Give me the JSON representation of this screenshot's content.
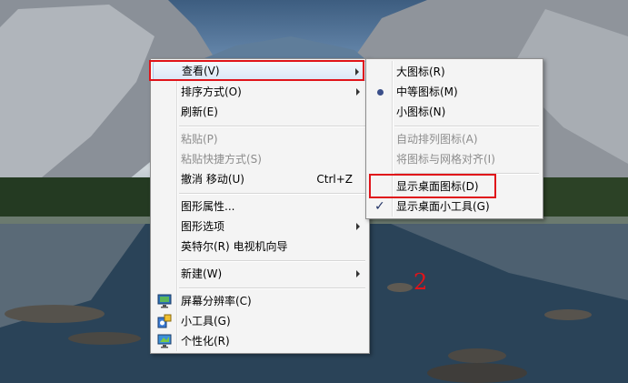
{
  "main_menu": {
    "items": [
      {
        "label": "查看(V)",
        "submenu": true,
        "highlighted": true
      },
      {
        "label": "排序方式(O)",
        "submenu": true
      },
      {
        "label": "刷新(E)"
      },
      {
        "label": "粘贴(P)",
        "disabled": true
      },
      {
        "label": "粘贴快捷方式(S)",
        "disabled": true
      },
      {
        "label": "撤消 移动(U)",
        "shortcut": "Ctrl+Z"
      },
      {
        "label": "图形属性..."
      },
      {
        "label": "图形选项",
        "submenu": true
      },
      {
        "label": "英特尔(R) 电视机向导"
      },
      {
        "label": "新建(W)",
        "submenu": true
      },
      {
        "label": "屏幕分辨率(C)",
        "icon": "display-icon"
      },
      {
        "label": "小工具(G)",
        "icon": "gadgets-icon"
      },
      {
        "label": "个性化(R)",
        "icon": "personalize-icon"
      }
    ]
  },
  "view_submenu": {
    "items": [
      {
        "label": "大图标(R)"
      },
      {
        "label": "中等图标(M)",
        "selected": true,
        "marker": "radio-bullet"
      },
      {
        "label": "小图标(N)"
      },
      {
        "label": "自动排列图标(A)",
        "disabled": true
      },
      {
        "label": "将图标与网格对齐(I)",
        "disabled": true
      },
      {
        "label": "显示桌面图标(D)"
      },
      {
        "label": "显示桌面小工具(G)",
        "checked": true,
        "marker": "✓"
      }
    ]
  },
  "annotation": {
    "step_number": "2",
    "color": "#e0141a"
  },
  "colors": {
    "menu_bg": "#f4f4f4",
    "highlight": "#dbe7f6",
    "annotation_red": "#e0141a"
  }
}
